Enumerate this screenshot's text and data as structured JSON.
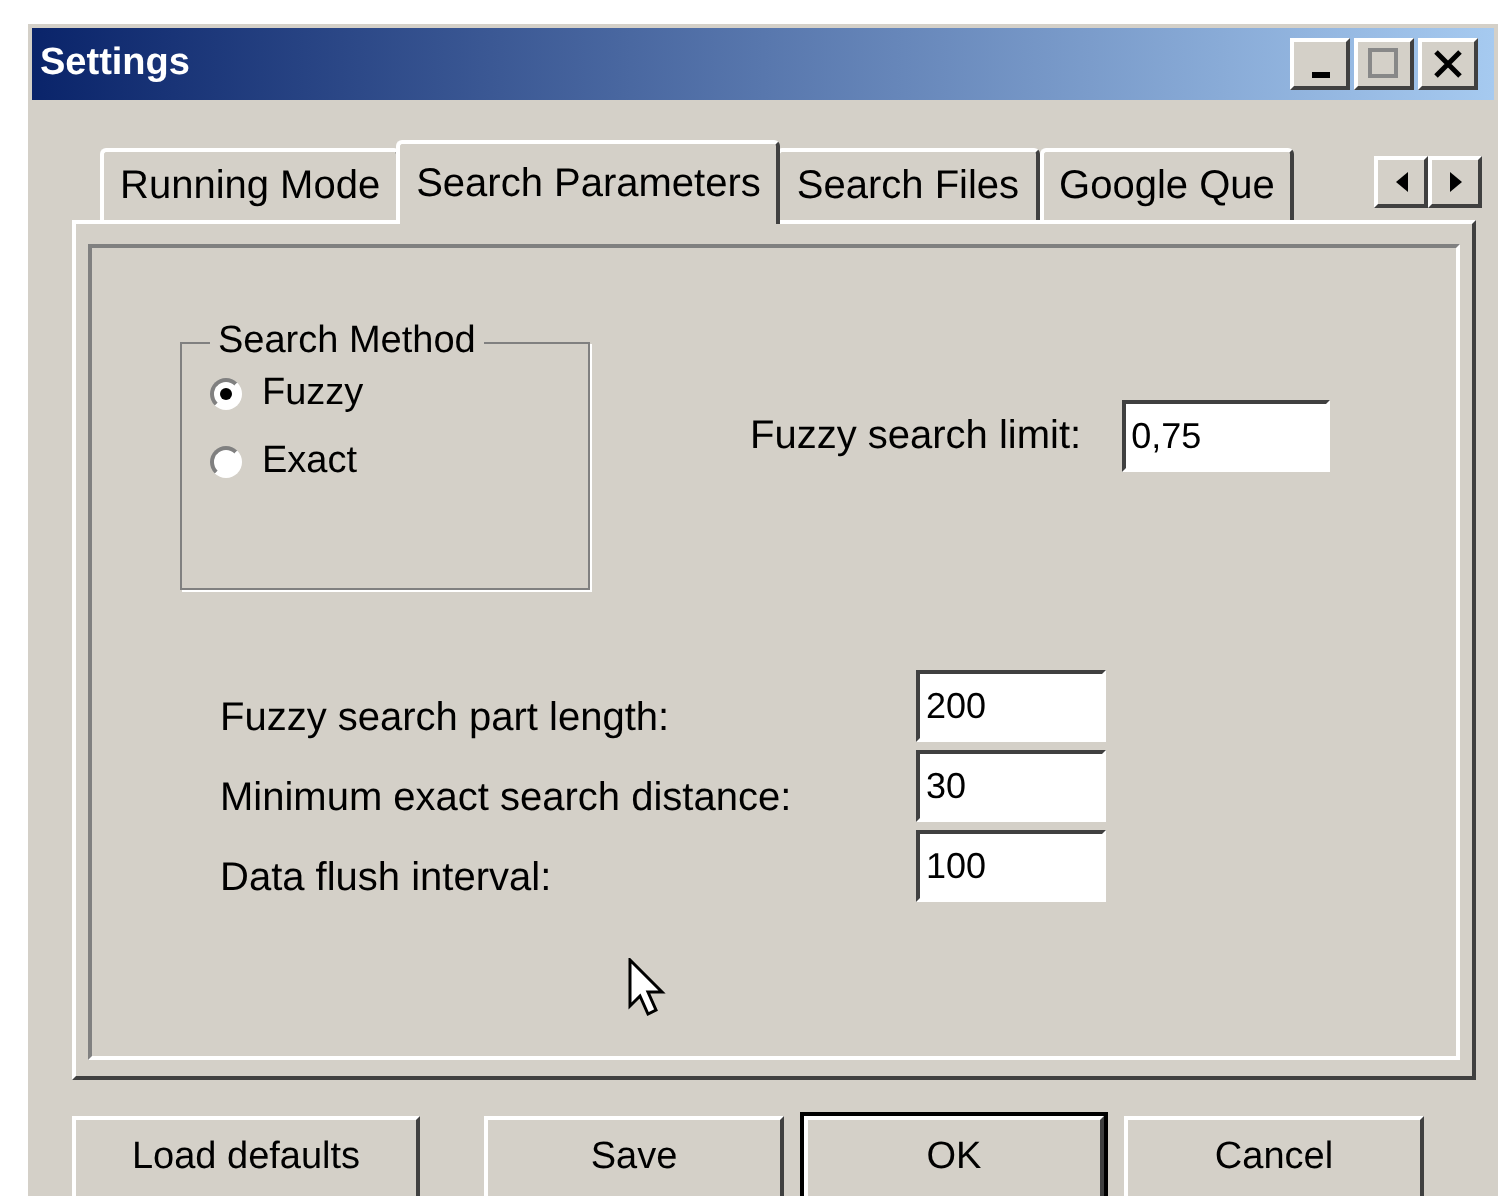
{
  "window": {
    "title": "Settings"
  },
  "tabs": [
    {
      "label": "Running Mode",
      "selected": false
    },
    {
      "label": "Search Parameters",
      "selected": true
    },
    {
      "label": "Search Files",
      "selected": false
    },
    {
      "label": "Google Que",
      "selected": false
    }
  ],
  "search_method": {
    "title": "Search Method",
    "options": [
      {
        "label": "Fuzzy",
        "selected": true
      },
      {
        "label": "Exact",
        "selected": false
      }
    ]
  },
  "fuzzy_limit": {
    "label": "Fuzzy search limit:",
    "value": "0,75"
  },
  "fields": [
    {
      "label": "Fuzzy search part length:",
      "value": "200"
    },
    {
      "label": "Minimum exact search distance:",
      "value": "30"
    },
    {
      "label": "Data flush interval:",
      "value": "100"
    }
  ],
  "buttons": [
    {
      "label": "Load defaults",
      "default": false
    },
    {
      "label": "Save",
      "default": false
    },
    {
      "label": "OK",
      "default": true
    },
    {
      "label": "Cancel",
      "default": false
    }
  ]
}
